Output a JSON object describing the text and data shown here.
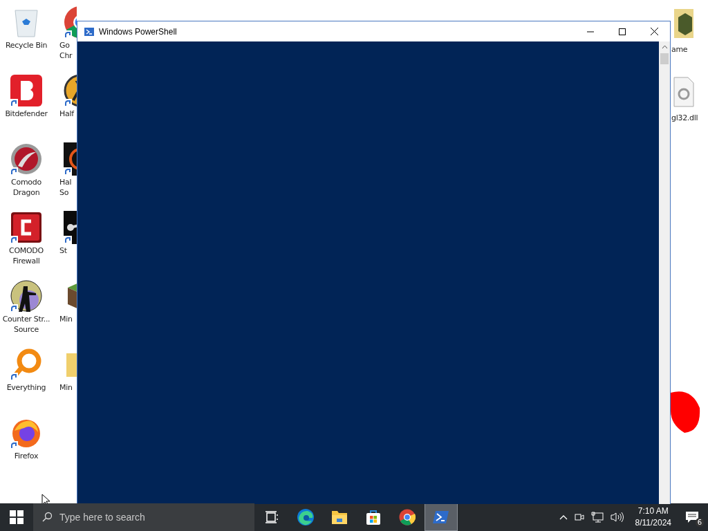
{
  "desktop": {
    "column_1": [
      {
        "kind": "recycle",
        "shortcut": false,
        "lines": [
          "Recycle Bin"
        ]
      },
      {
        "kind": "bitdefender",
        "shortcut": true,
        "lines": [
          "Bitdefender"
        ]
      },
      {
        "kind": "dragon",
        "shortcut": true,
        "lines": [
          "Comodo",
          "Dragon"
        ]
      },
      {
        "kind": "firewall",
        "shortcut": true,
        "lines": [
          "COMODO",
          "Firewall"
        ]
      },
      {
        "kind": "soldier",
        "shortcut": true,
        "lines": [
          "Counter Str...",
          "Source"
        ]
      },
      {
        "kind": "everything",
        "shortcut": true,
        "lines": [
          "Everything"
        ]
      },
      {
        "kind": "firefox",
        "shortcut": true,
        "lines": [
          "Firefox"
        ]
      }
    ],
    "column_2": [
      {
        "kind": "chrome",
        "shortcut": true,
        "lines": [
          "Go",
          "Chr"
        ]
      },
      {
        "kind": "halflife",
        "shortcut": true,
        "lines": [
          "Half"
        ]
      },
      {
        "kind": "dark",
        "shortcut": true,
        "lines": [
          "Hal",
          "So"
        ]
      },
      {
        "kind": "steam",
        "shortcut": true,
        "lines": [
          "St"
        ]
      },
      {
        "kind": "grass",
        "shortcut": false,
        "lines": [
          "Min"
        ]
      },
      {
        "kind": "folder",
        "shortcut": false,
        "lines": [
          "Min"
        ]
      }
    ],
    "column_right": [
      {
        "kind": "archive",
        "lines": [
          "ame"
        ]
      },
      {
        "kind": "file",
        "lines": [
          "gl32.dll"
        ]
      }
    ]
  },
  "window": {
    "title": "Windows PowerShell"
  },
  "taskbar": {
    "search": {
      "placeholder": "Type here to search"
    },
    "apps": [
      {
        "kind": "taskview",
        "selected": false
      },
      {
        "kind": "edge",
        "selected": false
      },
      {
        "kind": "explorer",
        "selected": false
      },
      {
        "kind": "store",
        "selected": false
      },
      {
        "kind": "chrome",
        "selected": false
      },
      {
        "kind": "powershell",
        "selected": true
      }
    ],
    "clock": {
      "time": "7:10 AM",
      "date": "8/11/2024"
    },
    "notifications": {
      "count": "6"
    }
  }
}
